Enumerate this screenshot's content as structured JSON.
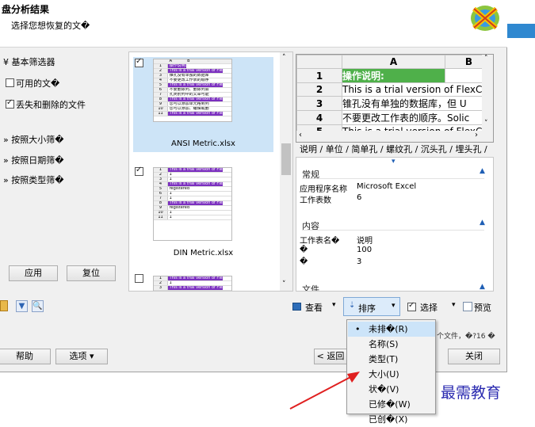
{
  "header": {
    "title": "盘分析结果",
    "subtitle": "选择您想恢复的文�"
  },
  "filters": {
    "basic": "基本筛选器",
    "options": [
      {
        "label": "可用的文�",
        "checked": false
      },
      {
        "label": "丢失和删除的文件",
        "checked": true
      }
    ],
    "by_size": "按照大小筛�",
    "by_date": "按照日期筛�",
    "by_type": "按照类型筛�",
    "apply": "应用",
    "reset": "复位"
  },
  "thumbnails": [
    {
      "name": "ANSI Metric.xlsx",
      "checked": true,
      "selected": true
    },
    {
      "name": "DIN Metric.xlsx",
      "checked": true,
      "selected": false
    },
    {
      "name": "",
      "checked": false,
      "selected": false
    }
  ],
  "thumb_rows_1": [
    "操作说明:",
    "This is a trial version of Fle",
    "锥孔没有单独的数据库",
    "不要更改工作表的顺序",
    "This is a trial version of Fle",
    "不要删除列、删除列会",
    "孔类别列中的文章可能",
    "This is a trial version of Fle",
    "您可以添加单元格到列",
    "您可以添加、编辑或删",
    "This is a trial version of Fle"
  ],
  "thumb_rows_2": [
    "This is a trial version of Fle",
    "1",
    "1",
    "This is a trial version of Fle",
    "registered",
    "1",
    "1",
    "This is a trial version of Fle",
    "registered",
    "1",
    "1"
  ],
  "thumb_rows_3": [
    "This is a trial version of Fle",
    "1",
    "This is a trial version of Fle"
  ],
  "preview": {
    "columns": [
      "A",
      "B"
    ],
    "rows": [
      {
        "n": "1",
        "a": "操作说明:",
        "b": ""
      },
      {
        "n": "2",
        "a": "This is a trial version of FlexCel, p",
        "b": ""
      },
      {
        "n": "3",
        "a": "锥孔没有单独的数据库，但 U",
        "b": ""
      },
      {
        "n": "4",
        "a": "不要更改工作表的顺序。Solic",
        "b": ""
      },
      {
        "n": "5",
        "a": "This is a trial version of FlexCel, p",
        "b": ""
      }
    ],
    "sheet_tabs": "说明 / 单位 / 简单孔 / 螺纹孔 / 沉头孔 / 埋头孔 /"
  },
  "properties": {
    "general": "常规",
    "app_label": "应用程序名称",
    "app_value": "Microsoft Excel",
    "sheets_label": "工作表数",
    "sheets_value": "6",
    "content": "内容",
    "sheetname_label": "工作表名�",
    "sheetname_value": "说明",
    "row1_label": "�",
    "row1_value": "100",
    "row2_label": "�",
    "row2_value": "3",
    "file": "文件"
  },
  "toolbar": {
    "view": "查看",
    "sort": "排序",
    "select": "选择",
    "preview": "预览",
    "status": "个文件，�?16 �"
  },
  "sort_menu": {
    "items": [
      "未排�(R)",
      "名称(S)",
      "类型(T)",
      "大小(U)",
      "状�(V)",
      "已修�(W)",
      "已创�(X)"
    ],
    "selected_index": 0
  },
  "footer": {
    "help": "帮助",
    "options": "选项 ▾",
    "back": "< 返回",
    "close": "关闭"
  },
  "watermark": "最需教育",
  "colors": {
    "selection": "#cde4f7",
    "accent_bar": "#2f88d0",
    "sheet_highlight": "#7b2fbf",
    "arrow": "#e02020",
    "watermark": "#2a2ab0"
  }
}
